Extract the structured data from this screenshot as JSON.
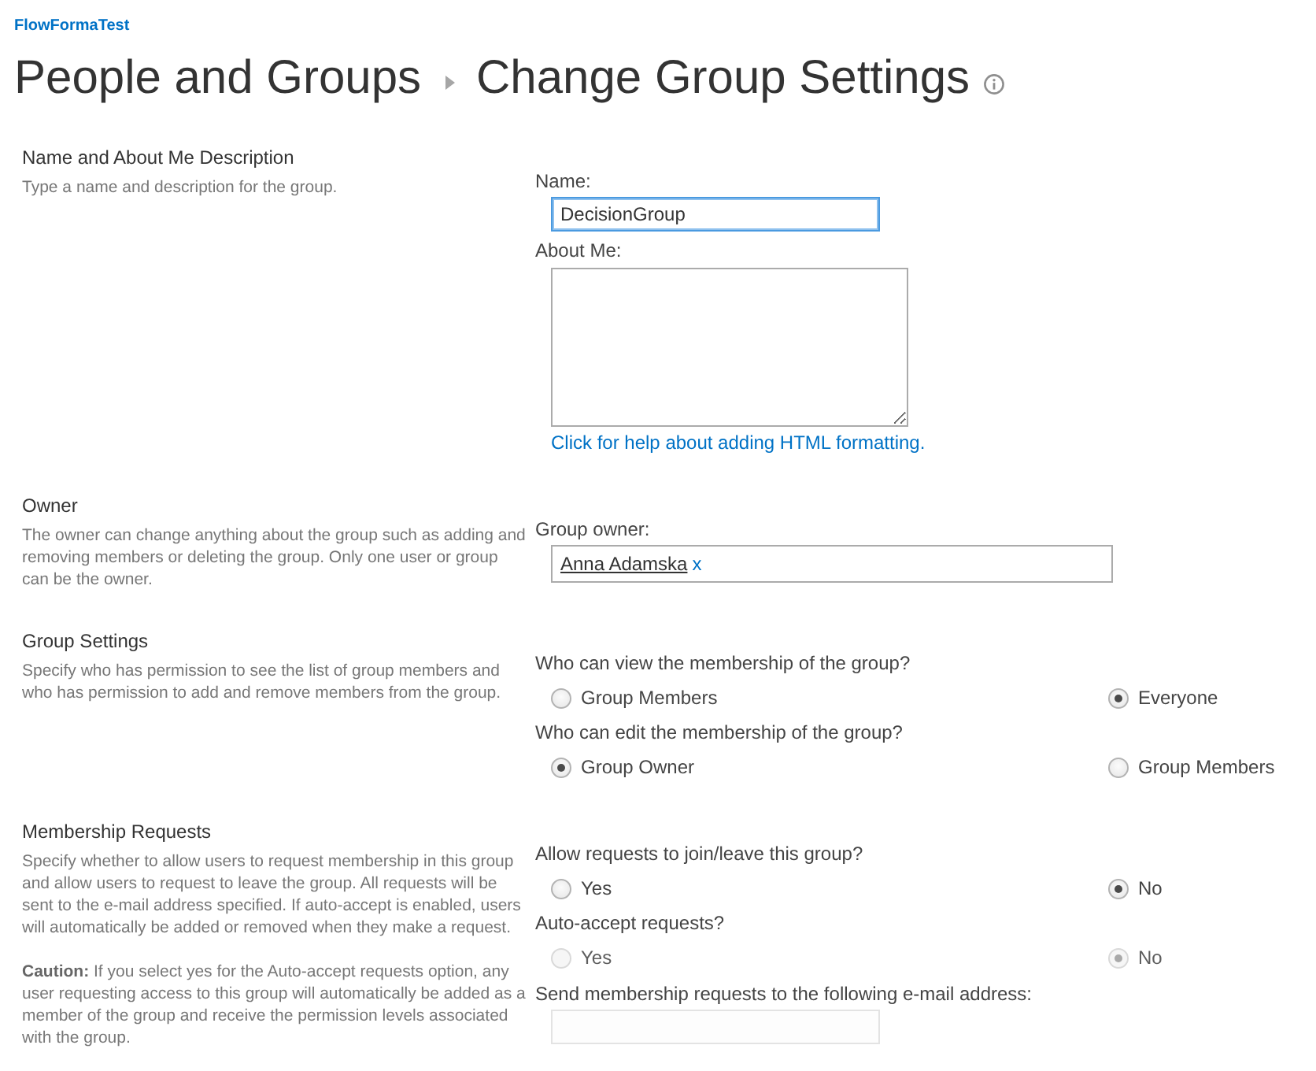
{
  "site_title": "FlowFormaTest",
  "breadcrumb": [
    {
      "label": "People and Groups"
    },
    {
      "label": "Change Group Settings"
    }
  ],
  "sections": [
    {
      "heading": "Name and About Me Description",
      "description": [
        "Type a name and description for the group."
      ],
      "fields": [
        {
          "kind": "text",
          "label": "Name:",
          "value": "DecisionGroup",
          "focused": true,
          "disabled": false
        },
        {
          "kind": "textarea",
          "label": "About Me:",
          "help_link": "Click for help about adding HTML formatting."
        }
      ]
    },
    {
      "heading": "Owner",
      "description": [
        "The owner can change anything about the group such as adding and removing members or deleting the group. Only one user or group can be the owner."
      ],
      "fields": [
        {
          "kind": "people",
          "label": "Group owner:",
          "people": [
            {
              "name": "Anna Adamska",
              "remove": "x"
            }
          ]
        }
      ]
    },
    {
      "heading": "Group Settings",
      "description": [
        "Specify who has permission to see the list of group members and who has permission to add and remove members from the group."
      ],
      "fields": [
        {
          "kind": "radio",
          "label": "Who can view the membership of the group?",
          "options": [
            {
              "label": "Group Members",
              "selected": false,
              "disabled": false
            },
            {
              "label": "Everyone",
              "selected": true,
              "disabled": false
            }
          ]
        },
        {
          "kind": "radio",
          "label": "Who can edit the membership of the group?",
          "options": [
            {
              "label": "Group Owner",
              "selected": true,
              "disabled": false
            },
            {
              "label": "Group Members",
              "selected": false,
              "disabled": false
            }
          ]
        }
      ]
    },
    {
      "heading": "Membership Requests",
      "description": [
        "Specify whether to allow users to request membership in this group and allow users to request to leave the group. All requests will be sent to the e-mail address specified. If auto-accept is enabled, users will automatically be added or removed when they make a request.",
        "**Caution:** If you select yes for the Auto-accept requests option, any user requesting access to this group will automatically be added as a member of the group and receive the permission levels associated with the group."
      ],
      "fields": [
        {
          "kind": "radio",
          "label": "Allow requests to join/leave this group?",
          "options": [
            {
              "label": "Yes",
              "selected": false,
              "disabled": false
            },
            {
              "label": "No",
              "selected": true,
              "disabled": false
            }
          ]
        },
        {
          "kind": "radio",
          "label": "Auto-accept requests?",
          "options": [
            {
              "label": "Yes",
              "selected": false,
              "disabled": true
            },
            {
              "label": "No",
              "selected": true,
              "disabled": true
            }
          ]
        },
        {
          "kind": "text",
          "label": "Send membership requests to the following e-mail address:",
          "focused": false,
          "disabled": true
        }
      ]
    }
  ]
}
